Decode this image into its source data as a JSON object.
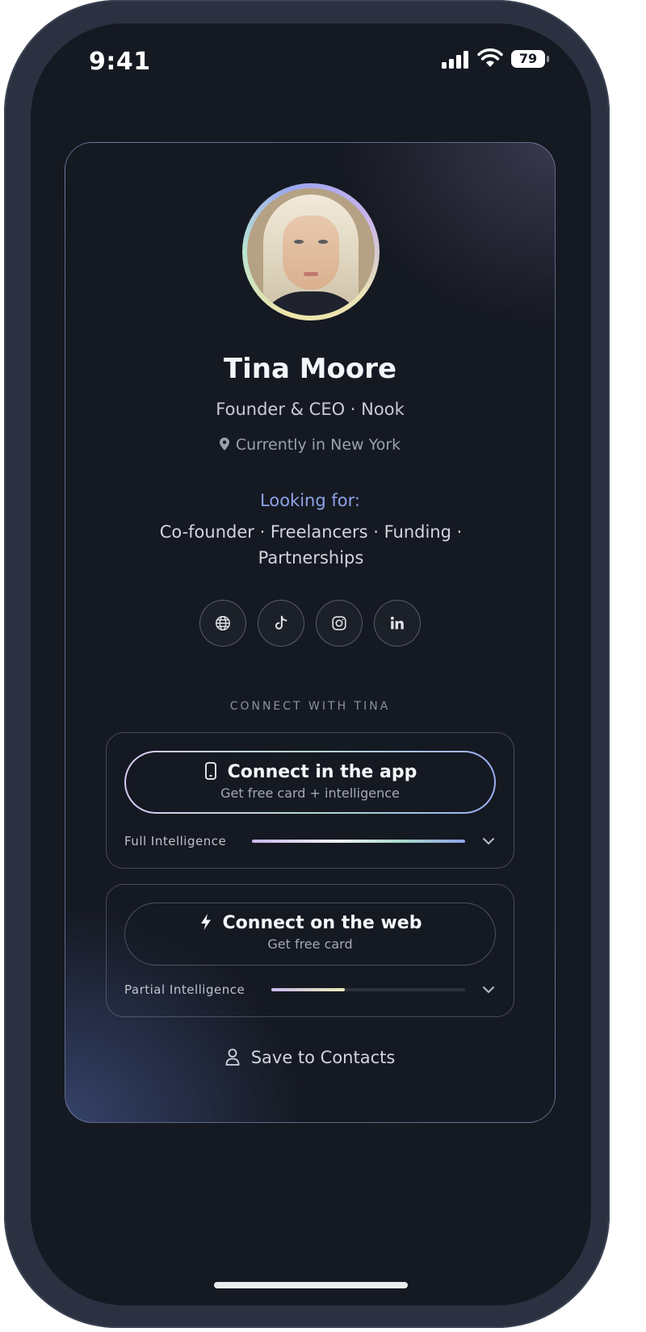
{
  "status_bar": {
    "time": "9:41",
    "battery": "79"
  },
  "profile": {
    "name": "Tina Moore",
    "role": "Founder & CEO · Nook",
    "location": "Currently in New York",
    "looking_for_label": "Looking for:",
    "looking_for_values": "Co-founder · Freelancers · Funding · Partnerships"
  },
  "socials": [
    {
      "icon": "globe-icon"
    },
    {
      "icon": "tiktok-icon"
    },
    {
      "icon": "instagram-icon"
    },
    {
      "icon": "linkedin-icon"
    }
  ],
  "connect": {
    "heading": "CONNECT WITH TINA",
    "app": {
      "title": "Connect in the app",
      "subtitle": "Get free card + intelligence",
      "intelligence_label": "Full Intelligence",
      "intelligence_level": 1.0
    },
    "web": {
      "title": "Connect on the web",
      "subtitle": "Get free card",
      "intelligence_label": "Partial Intelligence",
      "intelligence_level": 0.38
    }
  },
  "save_contacts": "Save to Contacts",
  "colors": {
    "accent": "#8ea3e8",
    "background": "#151922",
    "phone_frame": "#2b3140"
  }
}
